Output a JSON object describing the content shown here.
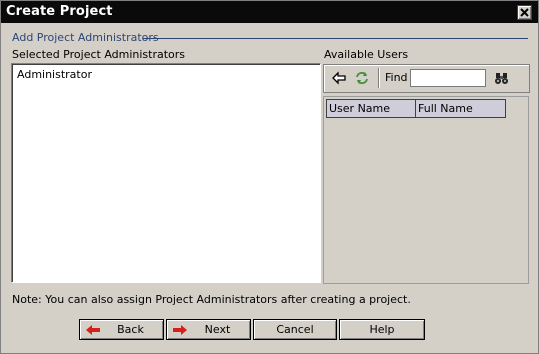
{
  "window": {
    "title": "Create Project",
    "close_icon": "close-icon"
  },
  "group": {
    "label": "Add Project Administrators"
  },
  "selected": {
    "label": "Selected Project Administrators",
    "items": [
      "Administrator"
    ]
  },
  "available": {
    "label": "Available Users",
    "toolbar": {
      "left_arrow_icon": "arrow-left-icon",
      "refresh_icon": "refresh-icon",
      "find_label": "Find",
      "find_value": "",
      "find_button_icon": "binoculars-icon"
    },
    "columns": [
      "User Name",
      "Full Name"
    ]
  },
  "note": "Note: You can also assign Project Administrators after creating a project.",
  "buttons": {
    "back": "Back",
    "next": "Next",
    "cancel": "Cancel",
    "help": "Help"
  },
  "colors": {
    "titlebar": "#0a0a0a",
    "dialog_bg": "#d4d0c8",
    "group_label": "#2d4677",
    "arrow": "#d8201a"
  }
}
